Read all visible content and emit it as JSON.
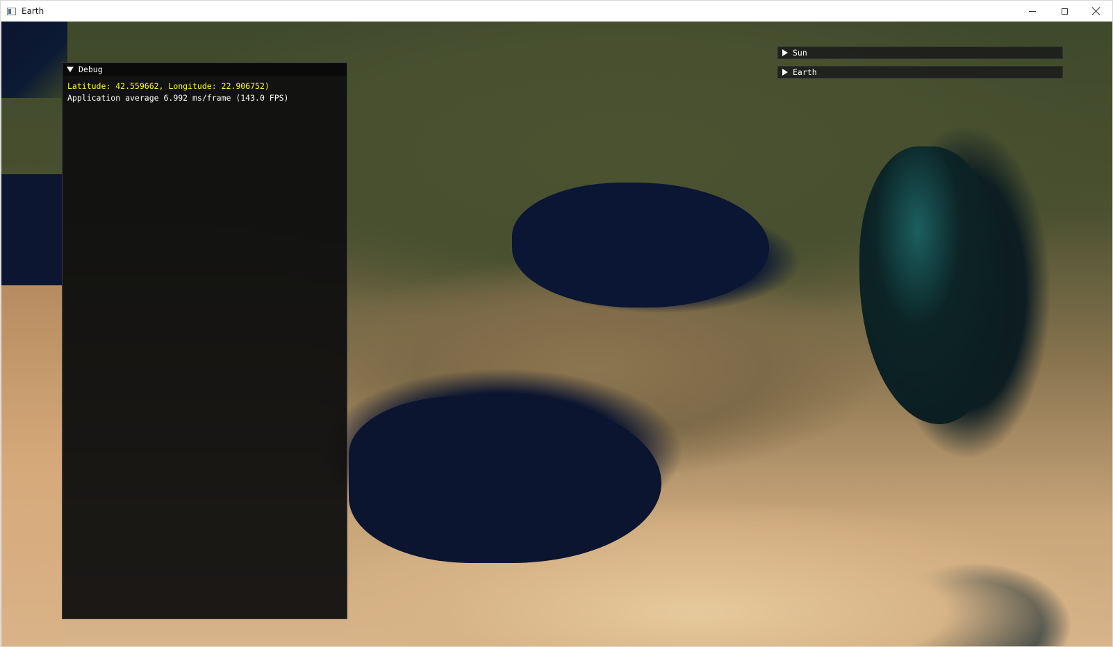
{
  "window": {
    "title": "Earth"
  },
  "debug": {
    "title": "Debug",
    "coordinates_text": "Latitude: 42.559662, Longitude: 22.906752)",
    "perf_text": "Application average 6.992 ms/frame (143.0 FPS)"
  },
  "panels": {
    "sun_label": "Sun",
    "earth_label": "Earth"
  },
  "colors": {
    "coordinates_text": "#ffff00",
    "panel_text": "#ffffff",
    "panel_bg": "#0f0f0f"
  },
  "icons": {
    "app": "app-window-icon",
    "minimize": "minimize-icon",
    "maximize": "maximize-icon",
    "close": "close-icon",
    "collapse_open": "triangle-down-icon",
    "collapse_closed": "triangle-right-icon"
  }
}
